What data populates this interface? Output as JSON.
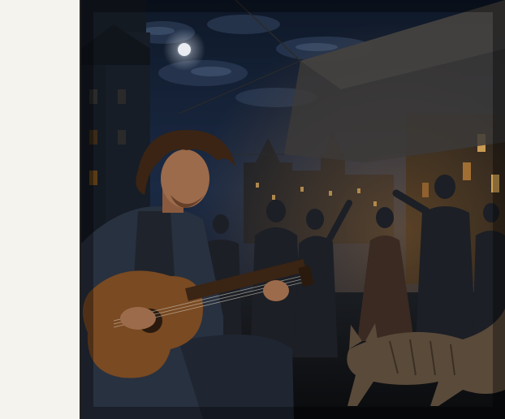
{
  "colors": {
    "page_bg": "#f4f3ee",
    "divider": "#222222",
    "sky_top": "#0e1828",
    "sky_mid": "#1b2a44",
    "moon": "#e9edf1",
    "awning": "#3c3a38",
    "guitar_body": "#7a4a22",
    "window_light": "#e7b663"
  },
  "icons": {
    "moon": "moon-icon",
    "guitar": "guitar-icon",
    "cat": "cat-icon"
  }
}
